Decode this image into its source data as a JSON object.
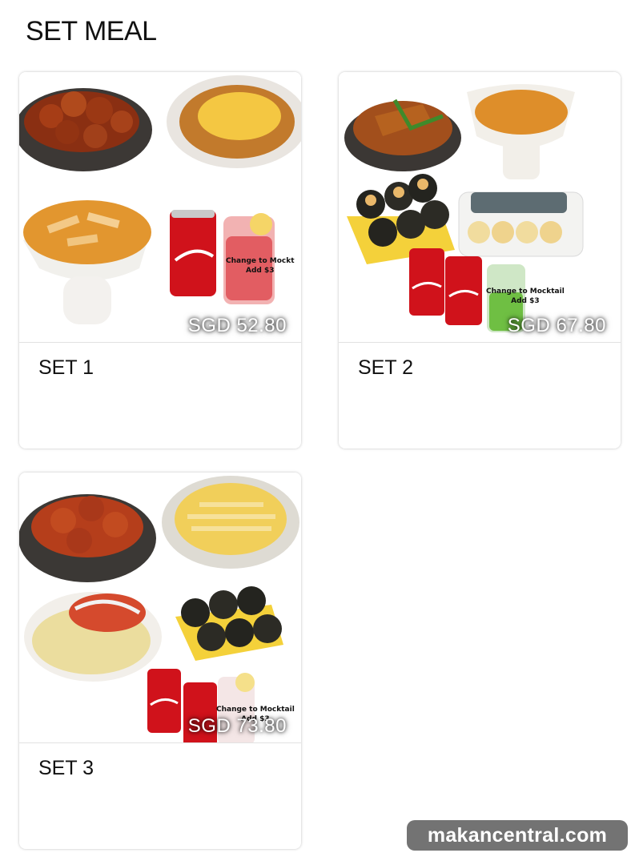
{
  "section": {
    "title": "SET MEAL"
  },
  "cards": [
    {
      "name": "SET 1",
      "price": "SGD 52.80",
      "note_line1": "Change to Mockt",
      "note_line2": "Add $3"
    },
    {
      "name": "SET 2",
      "price": "SGD 67.80",
      "note_line1": "Change to Mocktail",
      "note_line2": "Add $3"
    },
    {
      "name": "SET 3",
      "price": "SGD 73.80",
      "note_line1": "Change to Mocktail",
      "note_line2": "Add $3"
    }
  ],
  "watermark": "makancentral.com",
  "colors": {
    "coca_cola_red": "#d0121b",
    "sauce_orange": "#b7411b",
    "cheese_yellow": "#f2c94c"
  }
}
